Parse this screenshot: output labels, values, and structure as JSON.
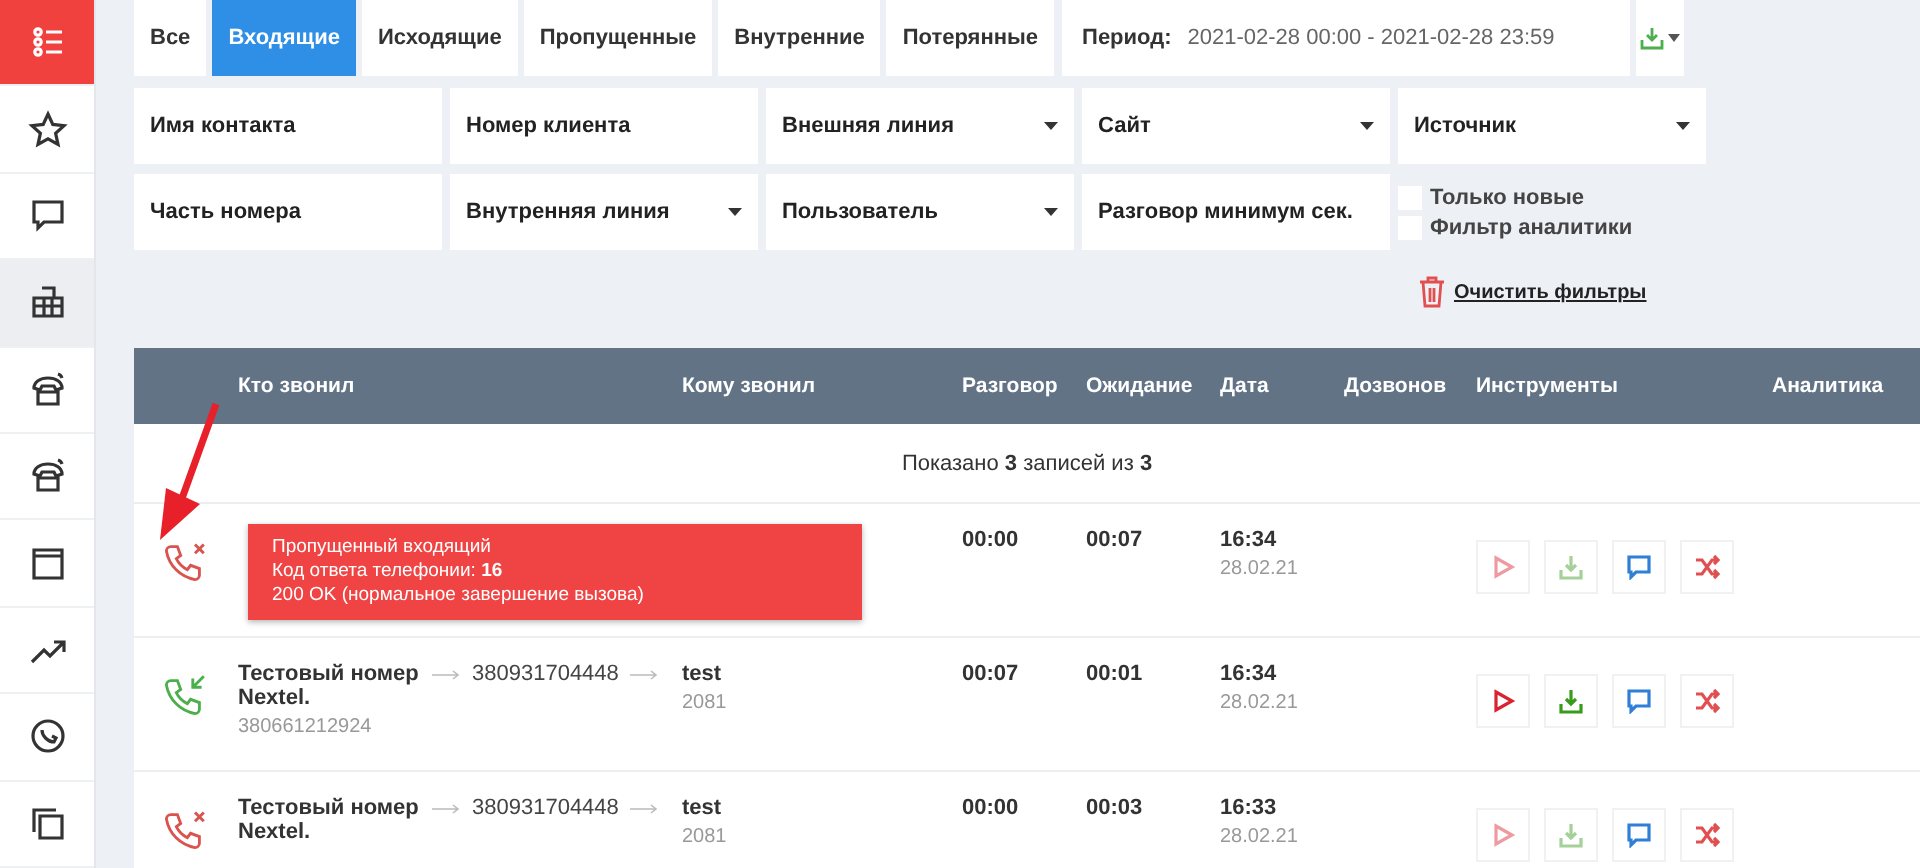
{
  "sidebar": {
    "items": [
      {
        "kind": "menu",
        "selected": false,
        "accent": true
      },
      {
        "kind": "star",
        "selected": false,
        "accent": false
      },
      {
        "kind": "chat",
        "selected": false,
        "accent": false
      },
      {
        "kind": "building",
        "selected": true,
        "accent": false
      },
      {
        "kind": "phone",
        "selected": false,
        "accent": false
      },
      {
        "kind": "phone",
        "selected": false,
        "accent": false
      },
      {
        "kind": "window",
        "selected": false,
        "accent": false
      },
      {
        "kind": "trend",
        "selected": false,
        "accent": false
      },
      {
        "kind": "clock",
        "selected": false,
        "accent": false
      },
      {
        "kind": "copy",
        "selected": false,
        "accent": false
      }
    ]
  },
  "tabs": [
    {
      "label": "Все",
      "selected": false
    },
    {
      "label": "Входящие",
      "selected": true
    },
    {
      "label": "Исходящие",
      "selected": false
    },
    {
      "label": "Пропущенные",
      "selected": false
    },
    {
      "label": "Внутренние",
      "selected": false
    },
    {
      "label": "Потерянные",
      "selected": false
    }
  ],
  "period": {
    "label": "Период:",
    "value": "2021-02-28 00:00 - 2021-02-28 23:59"
  },
  "filters": [
    {
      "kind": "input",
      "placeholder": "Имя контакта"
    },
    {
      "kind": "input",
      "placeholder": "Номер клиента"
    },
    {
      "kind": "select",
      "label": "Внешняя линия"
    },
    {
      "kind": "select",
      "label": "Сайт"
    },
    {
      "kind": "select",
      "label": "Источник"
    },
    {
      "kind": "input",
      "placeholder": "Часть номера"
    },
    {
      "kind": "select",
      "label": "Внутренняя линия"
    },
    {
      "kind": "select",
      "label": "Пользователь"
    },
    {
      "kind": "input",
      "placeholder": "Разговор минимум сек."
    }
  ],
  "checkboxes": [
    {
      "label": "Только новые",
      "checked": false
    },
    {
      "label": "Фильтр аналитики",
      "checked": false
    }
  ],
  "clear_filters": "Очистить фильтры",
  "table": {
    "columns": [
      "Кто звонил",
      "Кому звонил",
      "Разговор",
      "Ожидание",
      "Дата",
      "Дозвонов",
      "Инструменты",
      "Аналитика"
    ],
    "summary": "Показано **3** записей из **3**",
    "rows": [
      {
        "kind": "missed",
        "talk": "00:00",
        "wait": "00:07",
        "time": "16:34",
        "date": "28.02.21",
        "recording": false,
        "tooltip": [
          "Пропущенный входящий",
          "Код ответа телефонии: **16**",
          "200 OK (нормальное завершение вызова)"
        ]
      },
      {
        "kind": "incoming",
        "caller": "Тестовый номер Nextel.",
        "caller_number": "380661212924",
        "number": "380931704448",
        "callee": "test",
        "callee_ext": "2081",
        "talk": "00:07",
        "wait": "00:01",
        "time": "16:34",
        "date": "28.02.21",
        "recording": true
      },
      {
        "kind": "missed",
        "caller": "Тестовый номер Nextel.",
        "number": "380931704448",
        "callee": "test",
        "callee_ext": "2081",
        "talk": "00:00",
        "wait": "00:03",
        "time": "16:33",
        "date": "28.02.21",
        "recording": false
      }
    ]
  }
}
